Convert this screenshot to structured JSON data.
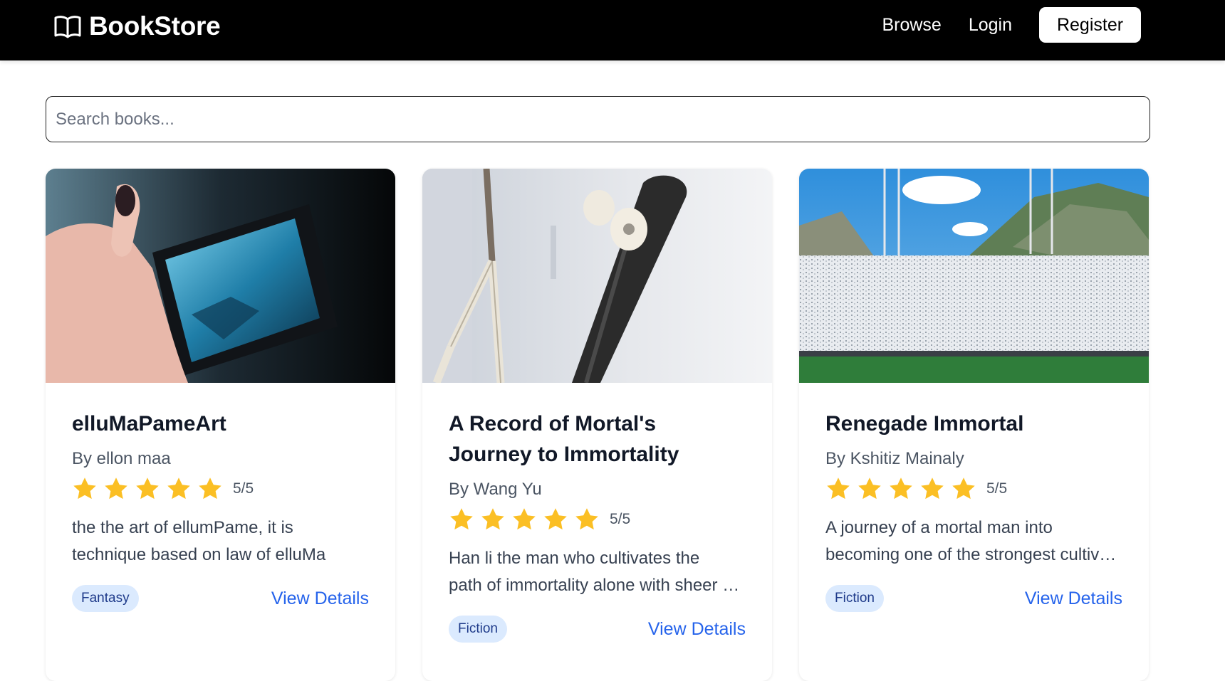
{
  "nav": {
    "brand": "BookStore",
    "links": [
      "Browse",
      "Login"
    ],
    "register_label": "Register"
  },
  "search": {
    "placeholder": "Search books...",
    "value": ""
  },
  "colors": {
    "star": "#fbbf24",
    "link": "#2563eb",
    "tag_bg": "#dbeafe"
  },
  "books": [
    {
      "title_lines": [
        "elluMaPameArt"
      ],
      "author": "By ellon maa",
      "rating": 5,
      "rating_text": "5/5",
      "description_lines": [
        "the the art of ellumPame, it is",
        "technique based on law of elluMa"
      ],
      "genre": "Fantasy",
      "link_label": "View Details",
      "image_icon": "phone-city-photo"
    },
    {
      "title_lines": [
        "A Record of Mortal's",
        "Journey to Immortality"
      ],
      "author": "By Wang Yu",
      "rating": 5,
      "rating_text": "5/5",
      "description_lines": [
        "Han li the man who cultivates the",
        "path of immortality alone with sheer determination"
      ],
      "genre": "Fiction",
      "link_label": "View Details",
      "image_icon": "skateboard-wall-photo"
    },
    {
      "title_lines": [
        "Renegade Immortal"
      ],
      "author": "By Kshitiz Mainaly",
      "rating": 5,
      "rating_text": "5/5",
      "description_lines": [
        "A journey of a mortal man into",
        "becoming one of the strongest cultivators"
      ],
      "genre": "Fiction",
      "link_label": "View Details",
      "image_icon": "stadium-photo"
    }
  ]
}
